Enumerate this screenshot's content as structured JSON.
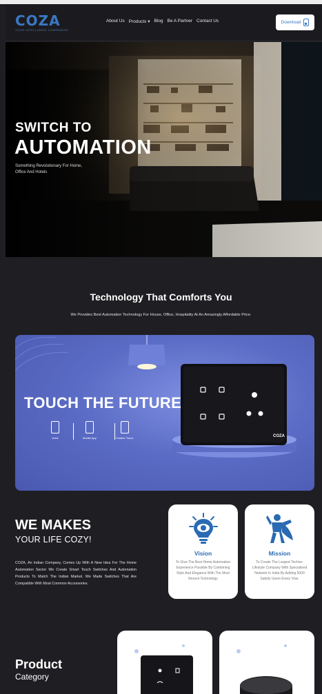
{
  "header": {
    "logo_text": "COZA",
    "logo_tagline": "YOUR INTELLIGENT COMPANION",
    "nav": [
      "About Us",
      "Products ▾",
      "Blog",
      "Be A Partner",
      "Contact Us"
    ],
    "download_label": "Download"
  },
  "hero": {
    "line1": "SWITCH TO",
    "line2": "AUTOMATION",
    "subtitle": "Something Revolutionary For Home, Office And Hotels"
  },
  "tech": {
    "title": "Technology That Comforts You",
    "subtitle": "We Provides Best Automation Technology For House, Office, Hospitality At An Amazingly Affordable Price."
  },
  "banner": {
    "title": "TOUCH THE FUTURE",
    "features": [
      "Voice",
      "Mobile App",
      "Feather Touch"
    ],
    "device_brand": "COZA"
  },
  "about": {
    "heading": "WE MAKES",
    "subheading": "YOUR LIFE COZY!",
    "text": "COZA, An Indian Company, Comes Up With A New Idea For The Home Automation Sector We Create Smart Touch Switches And Automation Products To Match The Indian Market. We Made Switches That Are Compatible With Most Common Accessories."
  },
  "cards": [
    {
      "title": "Vision",
      "text": "To Give The Best Home Automation Experience Possible By Combining Style And Elegance With The Most Recent Technology",
      "icon": "eye-bulb-icon"
    },
    {
      "title": "Mission",
      "text": "To Create The Largest Techno-Lifestyle Company With Specialised Network In India By Adding 5000 Satisfy Users Every Year.",
      "icon": "superhero-icon"
    }
  ],
  "product": {
    "title": "Product",
    "subtitle": "Category"
  },
  "colors": {
    "brand_blue": "#3a78c4",
    "page_bg": "#1f1f23",
    "banner_bg": "#5b6cc6"
  }
}
